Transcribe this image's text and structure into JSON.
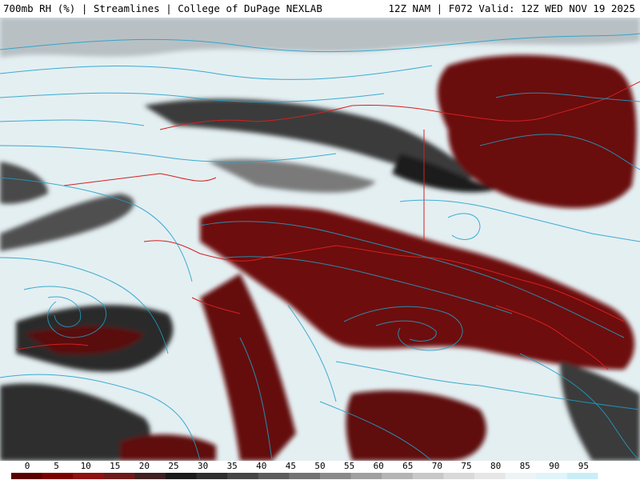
{
  "header": {
    "left": "700mb RH (%) | Streamlines | College of DuPage NEXLAB",
    "right": "12Z NAM | F072 Valid: 12Z WED NOV 19 2025"
  },
  "legend": {
    "ticks": [
      "0",
      "5",
      "10",
      "15",
      "20",
      "25",
      "30",
      "35",
      "40",
      "45",
      "50",
      "55",
      "60",
      "65",
      "70",
      "75",
      "80",
      "85",
      "90",
      "95"
    ],
    "colors": [
      "#5a0000",
      "#7a0000",
      "#8f1111",
      "#6e1a1a",
      "#402020",
      "#1a1a1a",
      "#2e2e2e",
      "#454545",
      "#5c5c5c",
      "#737373",
      "#8a8a8a",
      "#a0a0a0",
      "#b5b5b5",
      "#c8c8c8",
      "#d9d9d9",
      "#e6e6e6",
      "#eef4f6",
      "#e0f4fa",
      "#c9eef8",
      "#ffffff"
    ]
  },
  "colors": {
    "moist": "#e6f2f5",
    "dry": "#6e0b0b",
    "mid": "#2a2a2a",
    "streamline": "#1ea0c8",
    "border": "#d42020"
  }
}
